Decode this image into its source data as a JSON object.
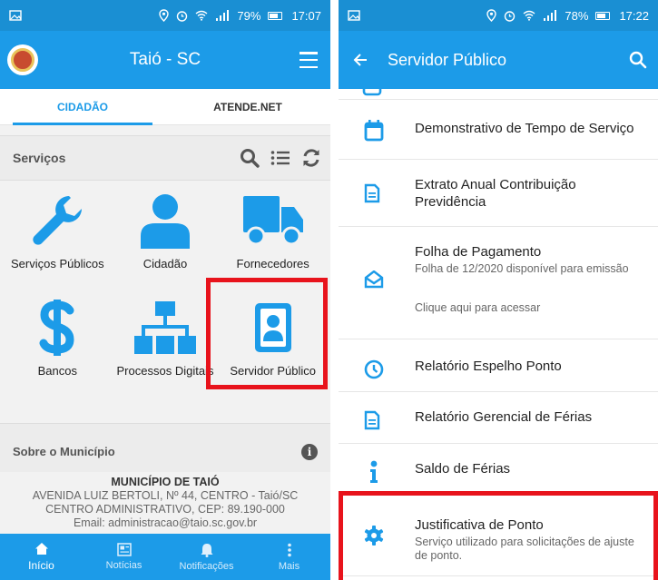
{
  "left": {
    "status": {
      "time": "17:07",
      "battery": "79%",
      "battery_level": 0.79
    },
    "header": {
      "title": "Taió - SC"
    },
    "tabs": [
      {
        "label": "CIDADÃO"
      },
      {
        "label": "ATENDE.NET"
      }
    ],
    "services": {
      "label": "Serviços",
      "items": [
        {
          "label": "Serviços Públicos",
          "icon": "wrench-icon"
        },
        {
          "label": "Cidadão",
          "icon": "person-icon"
        },
        {
          "label": "Fornecedores",
          "icon": "truck-icon"
        },
        {
          "label": "Bancos",
          "icon": "dollar-icon"
        },
        {
          "label": "Processos Digitais",
          "icon": "org-chart-icon"
        },
        {
          "label": "Servidor Público",
          "icon": "id-badge-icon"
        }
      ]
    },
    "about": {
      "label": "Sobre o Município"
    },
    "address": {
      "name": "MUNICÍPIO DE TAIÓ",
      "line1": "AVENIDA LUIZ BERTOLI, Nº 44, CENTRO - Taió/SC",
      "line2": "CENTRO ADMINISTRATIVO, CEP: 89.190-000",
      "line3": "Email: administracao@taio.sc.gov.br"
    },
    "nav": [
      {
        "label": "Início",
        "icon": "home-icon"
      },
      {
        "label": "Notícias",
        "icon": "news-icon"
      },
      {
        "label": "Notificações",
        "icon": "bell-icon"
      },
      {
        "label": "Mais",
        "icon": "more-vertical-icon"
      }
    ]
  },
  "right": {
    "status": {
      "time": "17:22",
      "battery": "78%",
      "battery_level": 0.78
    },
    "header": {
      "title": "Servidor Público"
    },
    "items": [
      {
        "title": "Demonstrativo de Tempo de Serviço",
        "icon": "calendar-icon"
      },
      {
        "title": "Extrato Anual Contribuição Previdência",
        "icon": "document-icon"
      },
      {
        "title": "Folha de Pagamento",
        "subtitle": "Folha de 12/2020 disponível para emissão",
        "extra": "Clique aqui para acessar",
        "icon": "envelope-open-icon"
      },
      {
        "title": "Relatório Espelho Ponto",
        "icon": "clock-icon"
      },
      {
        "title": "Relatório Gerencial de Férias",
        "icon": "document-icon"
      },
      {
        "title": "Saldo de Férias",
        "icon": "info-icon"
      },
      {
        "title": "Justificativa de Ponto",
        "subtitle": "Serviço utilizado para solicitações de ajuste de ponto.",
        "icon": "gear-icon"
      }
    ]
  },
  "colors": {
    "primary": "#1c9be8",
    "highlight": "#e8131c"
  }
}
